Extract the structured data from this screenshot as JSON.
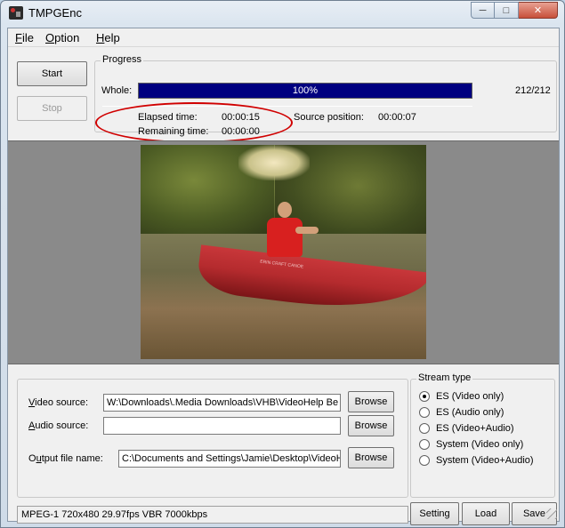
{
  "window": {
    "title": "TMPGEnc"
  },
  "menu": [
    {
      "label": "File",
      "underline": "F"
    },
    {
      "label": "Option",
      "underline": "O"
    },
    {
      "label": "Help",
      "underline": "H"
    }
  ],
  "controls": {
    "start_label": "Start",
    "stop_label": "Stop"
  },
  "progress": {
    "legend": "Progress",
    "whole_label": "Whole:",
    "percent_text": "100%",
    "percent_value": 100,
    "frames": "212/212",
    "elapsed_label": "Elapsed time:",
    "elapsed_value": "00:00:15",
    "remaining_label": "Remaining time:",
    "remaining_value": "00:00:00",
    "source_position_label": "Source position:",
    "source_position_value": "00:00:07"
  },
  "preview": {
    "canoe_text": "ERIN CRAFT CANOE"
  },
  "files": {
    "video_source_label": "Video source:",
    "video_source_value": "W:\\Downloads\\.Media Downloads\\VHB\\VideoHelp Be",
    "audio_source_label": "Audio source:",
    "audio_source_value": "",
    "output_label": "Output file name:",
    "output_value": "C:\\Documents and Settings\\Jamie\\Desktop\\VideoH",
    "browse_label": "Browse"
  },
  "stream_type": {
    "legend": "Stream type",
    "options": [
      {
        "label": "ES (Video only)",
        "checked": true
      },
      {
        "label": "ES (Audio only)",
        "checked": false
      },
      {
        "label": "ES (Video+Audio)",
        "checked": false
      },
      {
        "label": "System (Video only)",
        "checked": false
      },
      {
        "label": "System (Video+Audio)",
        "checked": false
      }
    ]
  },
  "status": {
    "text": "MPEG-1 720x480 29.97fps VBR 7000kbps"
  },
  "actions": {
    "setting_label": "Setting",
    "load_label": "Load",
    "save_label": "Save"
  },
  "colors": {
    "progress_fill": "#000080",
    "highlight_ellipse": "#d00000",
    "preview_bg": "#8a8a8a"
  }
}
